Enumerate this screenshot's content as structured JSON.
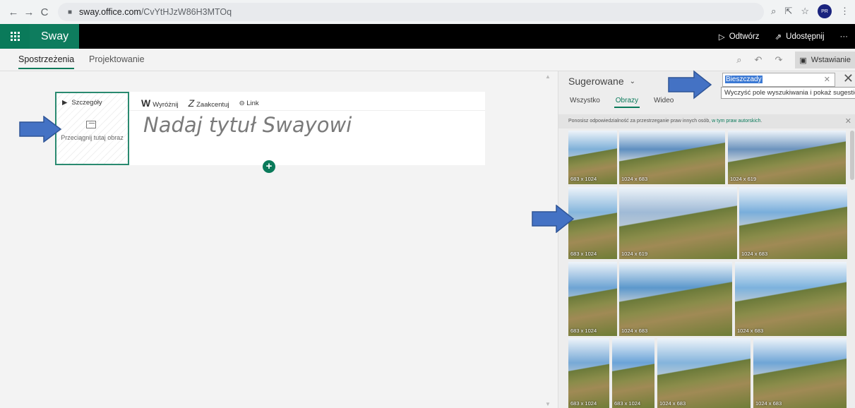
{
  "browser": {
    "url_host": "sway.office.com",
    "url_path": "/CvYtHJzW86H3MTOq",
    "profile_initials": "PR"
  },
  "appbar": {
    "app_name": "Sway",
    "play_label": "Odtwórz",
    "share_label": "Udostępnij",
    "more_label": "···"
  },
  "tabs": {
    "insights": "Spostrzeżenia",
    "design": "Projektowanie",
    "insert": "Wstawianie"
  },
  "card": {
    "details_label": "Szczegóły",
    "drop_label": "Przeciągnij tutaj obraz",
    "toolbar": {
      "highlight": "Wyróżnij",
      "emphasize": "Zaakcentuj",
      "link": "Link"
    },
    "title_placeholder": "Nadaj tytuł Swayowi"
  },
  "panel": {
    "suggested_label": "Sugerowane",
    "search_value": "Bieszczady",
    "tooltip": "Wyczyść pole wyszukiwania i pokaż sugestie",
    "tabs": [
      "Wszystko",
      "Obrazy",
      "Wideo"
    ],
    "active_tab": "Obrazy",
    "notice_text": "Ponosisz odpowiedzialność za przestrzeganie praw innych osób, ",
    "notice_link": "w tym praw autorskich",
    "notice_end": ".",
    "images": [
      {
        "dims": "683 x 1024"
      },
      {
        "dims": "1024 x 683"
      },
      {
        "dims": "1024 x 619"
      },
      {
        "dims": "683 x 1024"
      },
      {
        "dims": "1024 x 619"
      },
      {
        "dims": "1024 x 683"
      },
      {
        "dims": "683 x 1024"
      },
      {
        "dims": "1024 x 683"
      },
      {
        "dims": "1024 x 683"
      },
      {
        "dims": "683 x 1024"
      },
      {
        "dims": "683 x 1024"
      },
      {
        "dims": "1024 x 683"
      },
      {
        "dims": "1024 x 683"
      }
    ]
  },
  "colors": {
    "accent": "#0a7a5a",
    "arrow": "#4472c4"
  }
}
